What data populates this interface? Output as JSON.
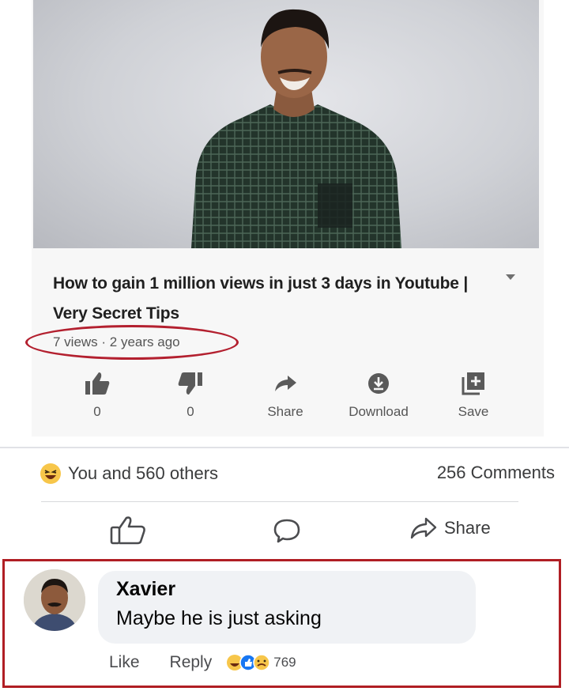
{
  "video": {
    "title": "How to gain 1 million views in just 3 days in Youtube | Very Secret Tips",
    "meta": "7 views · 2 years ago",
    "actions": [
      {
        "icon": "thumbs-up-icon",
        "label": "0"
      },
      {
        "icon": "thumbs-down-icon",
        "label": "0"
      },
      {
        "icon": "share-arrow-icon",
        "label": "Share"
      },
      {
        "icon": "download-icon",
        "label": "Download"
      },
      {
        "icon": "save-playlist-icon",
        "label": "Save"
      }
    ]
  },
  "post": {
    "reactions_text": "You and 560 others",
    "comments_text": "256 Comments",
    "actions": {
      "like_icon": "like-outline-icon",
      "comment_icon": "comment-bubble-icon",
      "share_label": "Share"
    }
  },
  "comment": {
    "author": "Xavier",
    "text": "Maybe he is just asking",
    "like_label": "Like",
    "reply_label": "Reply",
    "reaction_count": "769"
  },
  "colors": {
    "highlight_red": "#b01e24",
    "fb_bubble": "#f0f2f5",
    "yt_card": "#f7f7f7"
  }
}
